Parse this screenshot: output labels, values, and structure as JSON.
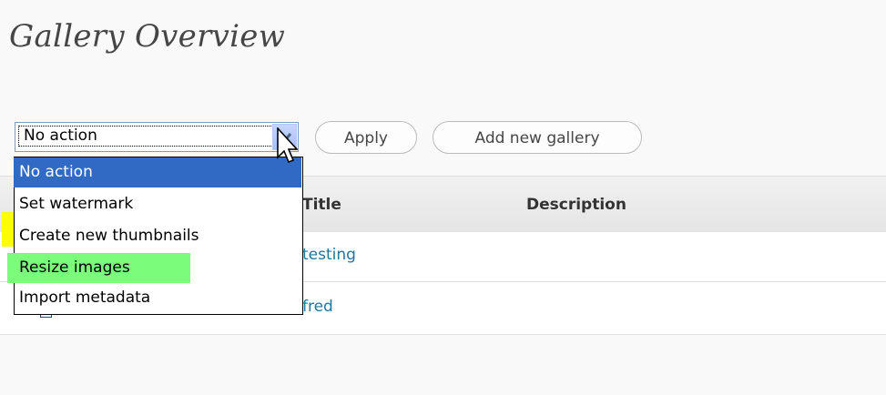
{
  "page": {
    "title": "Gallery Overview"
  },
  "toolbar": {
    "bulk_action_selected": "No action",
    "apply_label": "Apply",
    "add_gallery_label": "Add new gallery"
  },
  "dropdown": {
    "options": [
      "No action",
      "Set watermark",
      "Create new thumbnails",
      "Resize images",
      "Import metadata"
    ],
    "selected_index": 0
  },
  "table": {
    "columns": [
      "Title",
      "Description"
    ],
    "rows": [
      {
        "title": "testing",
        "description": ""
      },
      {
        "title": "fred",
        "description": ""
      }
    ]
  },
  "colors": {
    "highlight_yellow": "#ffff00",
    "highlight_green": "#7bfc7b",
    "selection_blue": "#316ac5",
    "link": "#21759b"
  },
  "icons": {
    "select_arrow": "chevron-down-icon",
    "cursor": "mouse-pointer-icon"
  }
}
